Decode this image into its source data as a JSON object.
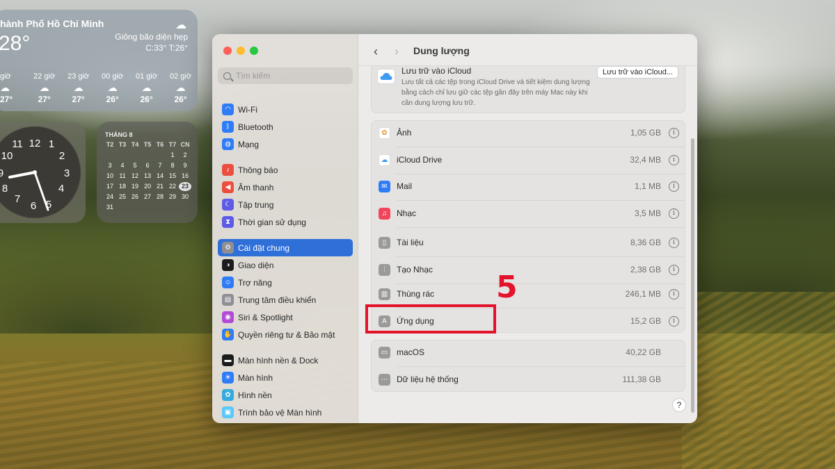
{
  "weather": {
    "city": "hành Phố Hồ Chí Minh",
    "temp": "28°",
    "condition": "Giông bão diện hẹp",
    "hilo": "C:33° T:26°",
    "hours": [
      {
        "time": "giờ",
        "temp": "27°"
      },
      {
        "time": "22 giờ",
        "temp": "27°"
      },
      {
        "time": "23 giờ",
        "temp": "27°"
      },
      {
        "time": "00 giờ",
        "temp": "26°"
      },
      {
        "time": "01 giờ",
        "temp": "26°"
      },
      {
        "time": "02 giờ",
        "temp": "26°"
      }
    ]
  },
  "clock": {
    "numbers": [
      "12",
      "11",
      "1",
      "10",
      "2",
      "9",
      "3",
      "8",
      "4",
      "7",
      "5",
      "6"
    ]
  },
  "calendar": {
    "month": "THÁNG 8",
    "weekdays": [
      "T2",
      "T3",
      "T4",
      "T5",
      "T6",
      "T7",
      "CN"
    ],
    "days": [
      "",
      "",
      "",
      "",
      "",
      "1",
      "2",
      "3",
      "4",
      "5",
      "6",
      "7",
      "8",
      "9",
      "10",
      "11",
      "12",
      "13",
      "14",
      "15",
      "16",
      "17",
      "18",
      "19",
      "20",
      "21",
      "22",
      "23",
      "24",
      "25",
      "26",
      "27",
      "28",
      "29",
      "30",
      "31"
    ],
    "today": "23"
  },
  "sidebar": {
    "search_placeholder": "Tìm kiếm",
    "items": [
      {
        "label": "Wi-Fi",
        "icon": "wifi-icon",
        "color": "#2f7cf6"
      },
      {
        "label": "Bluetooth",
        "icon": "bluetooth-icon",
        "color": "#2f7cf6"
      },
      {
        "label": "Mạng",
        "icon": "globe-icon",
        "color": "#2f7cf6"
      },
      {
        "label": "Thông báo",
        "icon": "bell-icon",
        "color": "#eb4e3d"
      },
      {
        "label": "Âm thanh",
        "icon": "speaker-icon",
        "color": "#eb4e3d"
      },
      {
        "label": "Tập trung",
        "icon": "moon-icon",
        "color": "#5e5ce6"
      },
      {
        "label": "Thời gian sử dụng",
        "icon": "hourglass-icon",
        "color": "#5e5ce6"
      },
      {
        "label": "Cài đặt chung",
        "icon": "gear-icon",
        "color": "#8e8e93"
      },
      {
        "label": "Giao diện",
        "icon": "appearance-icon",
        "color": "#1c1c1e"
      },
      {
        "label": "Trợ năng",
        "icon": "accessibility-icon",
        "color": "#2f7cf6"
      },
      {
        "label": "Trung tâm điều khiển",
        "icon": "control-center-icon",
        "color": "#8e8e93"
      },
      {
        "label": "Siri & Spotlight",
        "icon": "siri-icon",
        "color": "#b24ad6"
      },
      {
        "label": "Quyền riêng tư & Bảo mật",
        "icon": "hand-icon",
        "color": "#2f7cf6"
      },
      {
        "label": "Màn hình nền & Dock",
        "icon": "dock-icon",
        "color": "#1c1c1e"
      },
      {
        "label": "Màn hình",
        "icon": "sun-icon",
        "color": "#2f7cf6"
      },
      {
        "label": "Hình nền",
        "icon": "flower-icon",
        "color": "#35aadc"
      },
      {
        "label": "Trình bảo vệ Màn hình",
        "icon": "screensaver-icon",
        "color": "#5ac8fa"
      }
    ]
  },
  "content": {
    "title": "Dung lượng",
    "icloud": {
      "title": "Lưu trữ vào iCloud",
      "description": "Lưu tất cả các tệp trong iCloud Drive và tiết kiệm dung lượng bằng cách chỉ lưu giữ các tệp gần đây trên máy Mac này khi cần dung lượng lưu trữ.",
      "button": "Lưu trữ vào iCloud..."
    },
    "items": [
      {
        "label": "Ảnh",
        "size": "1,05 GB",
        "icon": "photos-icon",
        "color": "#ffffff"
      },
      {
        "label": "iCloud Drive",
        "size": "32,4 MB",
        "icon": "icloud-icon",
        "color": "#ffffff"
      },
      {
        "label": "Mail",
        "size": "1,1 MB",
        "icon": "mail-icon",
        "color": "#2f7cf6"
      },
      {
        "label": "Nhạc",
        "size": "3,5 MB",
        "icon": "music-icon",
        "color": "#f0455b"
      },
      {
        "label": "Tài liệu",
        "size": "8,36 GB",
        "icon": "document-icon",
        "color": "#9a9a9a"
      },
      {
        "label": "Tạo Nhạc",
        "size": "2,38 GB",
        "icon": "sliders-icon",
        "color": "#9a9a9a"
      },
      {
        "label": "Thùng rác",
        "size": "246,1 MB",
        "icon": "trash-icon",
        "color": "#9a9a9a"
      },
      {
        "label": "Ứng dụng",
        "size": "15,2 GB",
        "icon": "app-store-icon",
        "color": "#9a9a9a"
      }
    ],
    "system_items": [
      {
        "label": "macOS",
        "size": "40,22 GB",
        "icon": "laptop-icon",
        "color": "#9a9a9a"
      },
      {
        "label": "Dữ liệu hệ thống",
        "size": "111,38 GB",
        "icon": "ellipsis-icon",
        "color": "#9a9a9a"
      }
    ],
    "help": "?"
  },
  "annotation": {
    "number": "5",
    "color": "#e4132c"
  }
}
